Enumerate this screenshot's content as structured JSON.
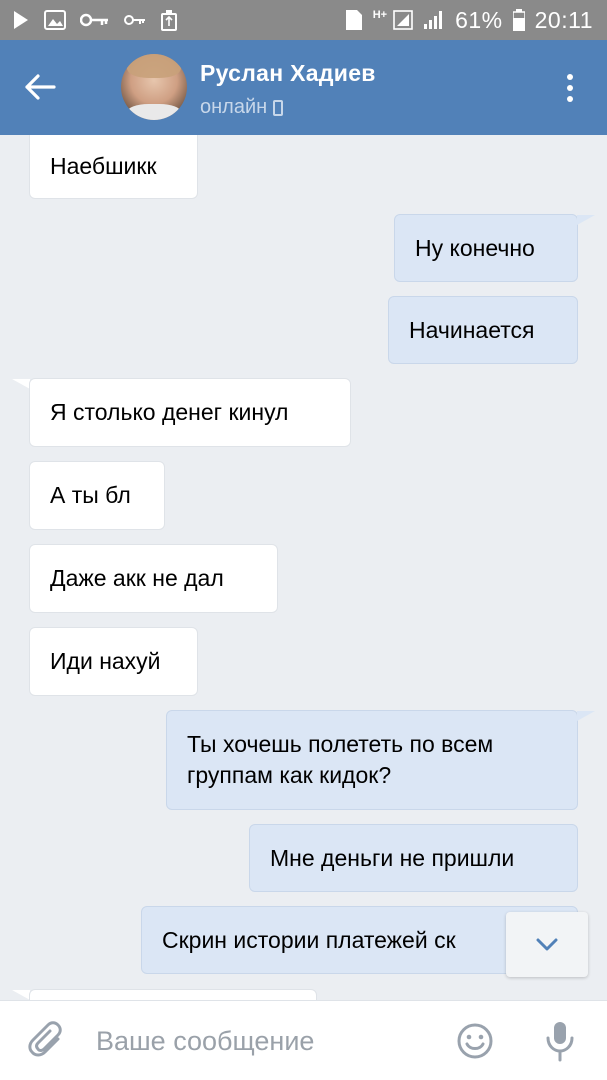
{
  "status_bar": {
    "sim_label": "1",
    "network_label": "H+",
    "battery_percent": "61%",
    "time": "20:11"
  },
  "header": {
    "contact_name": "Руслан Хадиев",
    "contact_status": "онлайн"
  },
  "messages": [
    {
      "direction": "in",
      "text": "Наебшикк"
    },
    {
      "direction": "out",
      "text": "Ну конечно"
    },
    {
      "direction": "out",
      "text": "Начинается"
    },
    {
      "direction": "in",
      "text": "Я столько денег кинул"
    },
    {
      "direction": "in",
      "text": "А ты бл"
    },
    {
      "direction": "in",
      "text": "Даже акк не дал"
    },
    {
      "direction": "in",
      "text": "Иди нахуй"
    },
    {
      "direction": "out",
      "text": "Ты хочешь полететь по всем группам как кидок?"
    },
    {
      "direction": "out",
      "text": "Мне деньги не пришли"
    },
    {
      "direction": "out",
      "text": "Скрин истории платежей ск"
    },
    {
      "direction": "in",
      "text": ""
    }
  ],
  "composer": {
    "placeholder": "Ваше сообщение",
    "value": ""
  },
  "colors": {
    "header": "#5181b8",
    "background": "#ebeef2",
    "incoming_bubble": "#ffffff",
    "outgoing_bubble": "#dbe6f5"
  },
  "icons": {
    "back": "arrow-left-icon",
    "menu": "more-vertical-icon",
    "attach": "paperclip-icon",
    "emoji": "smiley-icon",
    "mic": "microphone-icon",
    "scroll": "chevron-down-icon"
  }
}
